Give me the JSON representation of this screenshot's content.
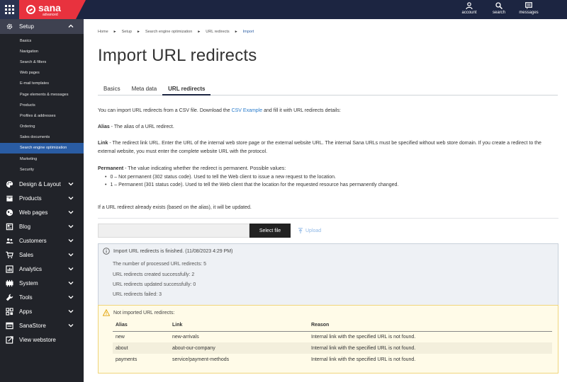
{
  "brand": {
    "name": "sana",
    "edition": "advanced"
  },
  "header": {
    "actions": [
      {
        "label": "account",
        "icon": "account-icon"
      },
      {
        "label": "search",
        "icon": "search-icon"
      },
      {
        "label": "messages",
        "icon": "messages-icon"
      }
    ]
  },
  "sidebar": {
    "setup": {
      "label": "Setup",
      "items": [
        "Basics",
        "Navigation",
        "Search & filters",
        "Web pages",
        "E-mail templates",
        "Page elements & messages",
        "Products",
        "Profiles & addresses",
        "Ordering",
        "Sales documents",
        "Search engine optimization",
        "Marketing",
        "Security"
      ],
      "active_item": "Search engine optimization"
    },
    "sections": [
      {
        "label": "Design & Layout",
        "icon": "palette-icon"
      },
      {
        "label": "Products",
        "icon": "box-icon"
      },
      {
        "label": "Web pages",
        "icon": "globe-icon"
      },
      {
        "label": "Blog",
        "icon": "blog-icon"
      },
      {
        "label": "Customers",
        "icon": "users-icon"
      },
      {
        "label": "Sales",
        "icon": "cart-icon"
      },
      {
        "label": "Analytics",
        "icon": "analytics-icon"
      },
      {
        "label": "System",
        "icon": "system-icon"
      },
      {
        "label": "Tools",
        "icon": "wrench-icon"
      },
      {
        "label": "Apps",
        "icon": "apps-icon"
      },
      {
        "label": "SanaStore",
        "icon": "store-icon"
      }
    ],
    "view_webstore": "View webstore"
  },
  "breadcrumb": [
    "Home",
    "Setup",
    "Search engine optimization",
    "URL redirects",
    "Import"
  ],
  "page_title": "Import URL redirects",
  "tabs": [
    "Basics",
    "Meta data",
    "URL redirects"
  ],
  "active_tab": "URL redirects",
  "intro": {
    "before": "You can import URL redirects from a CSV file. Download the ",
    "link": "CSV Example",
    "after": " and fill it with URL redirects details:"
  },
  "alias": {
    "label": "Alias",
    "text": " - The alias of a URL redirect."
  },
  "link_desc": {
    "label": "Link",
    "text": " - The redirect link URL. Enter the URL of the internal web store page or the external website URL. The internal Sana URLs must be specified without web store domain. If you create a redirect to the external website, you must enter the complete website URL with the protocol."
  },
  "permanent": {
    "label": "Permanent",
    "text": " - The value indicating whether the redirect is permanent. Possible values:",
    "values": [
      "0 – Not permanent (302 status code). Used to tell the Web client to issue a new request to the location.",
      "1 – Permanent (301 status code). Used to tell the Web client that the location for the requested resource has permanently changed."
    ]
  },
  "update_note": "If a URL redirect already exists (based on the alias), it will be updated.",
  "file": {
    "select_label": "Select file",
    "upload_label": "Upload"
  },
  "result": {
    "title": "Import URL redirects is finished. (11/08/2023 4:29 PM)",
    "lines": [
      "The number of processed URL redirects: 5",
      "URL redirects created successfully: 2",
      "URL redirects updated successfully: 0",
      "URL redirects failed: 3"
    ]
  },
  "not_imported": {
    "title": "Not imported URL redirects:",
    "columns": [
      "Alias",
      "Link",
      "Reason"
    ],
    "rows": [
      [
        "new",
        "new-arrivals",
        "Internal link with the specified URL is not found."
      ],
      [
        "about",
        "about-our-company",
        "Internal link with the specified URL is not found."
      ],
      [
        "payments",
        "service/payment-methods",
        "Internal link with the specified URL is not found."
      ]
    ]
  },
  "colors": {
    "topbar": "#1c2541",
    "brand_red": "#e8323e",
    "sidebar": "#212329",
    "active_nav": "#2a5ca3",
    "link": "#2a7ccc"
  }
}
